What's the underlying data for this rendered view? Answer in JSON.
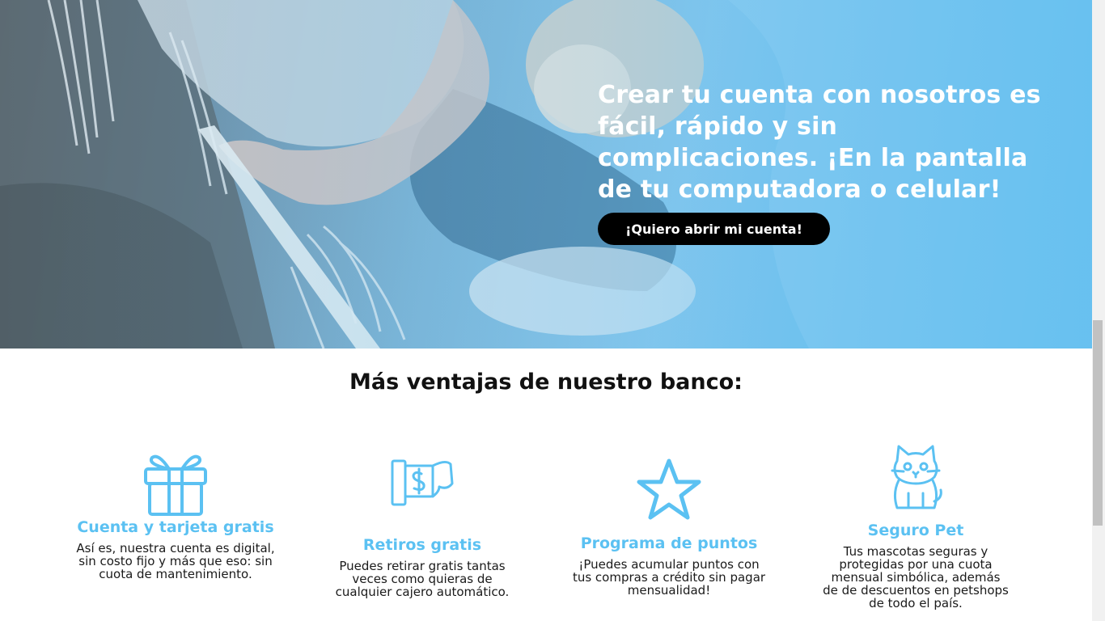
{
  "hero": {
    "title": "Crear tu cuenta con nosotros es fácil, rápido y sin complicaciones. ¡En la pantalla de tu computadora o celular!",
    "cta_label": "¡Quiero abrir mi cuenta!",
    "overlay_color": "#5dbdf0"
  },
  "section": {
    "title": "Más ventajas de nuestro banco:"
  },
  "features": [
    {
      "icon": "gift-icon",
      "title": "Cuenta y tarjeta gratis",
      "description": "Así es, nuestra cuenta es digital, sin costo fijo y más que eso: sin cuota de mantenimiento."
    },
    {
      "icon": "cash-withdrawal-icon",
      "title": "Retiros gratis",
      "description": "Puedes retirar gratis tantas veces como quieras de cualquier cajero automático."
    },
    {
      "icon": "star-icon",
      "title": "Programa de puntos",
      "description": "¡Puedes acumular puntos con tus compras a crédito sin pagar mensualidad!"
    },
    {
      "icon": "cat-icon",
      "title": "Seguro Pet",
      "description": "Tus mascotas seguras y protegidas por una cuota mensual simbólica, además de de descuentos en petshops de todo el país."
    }
  ],
  "colors": {
    "accent": "#5bc1f2",
    "button": "#000000",
    "text": "#111111"
  }
}
